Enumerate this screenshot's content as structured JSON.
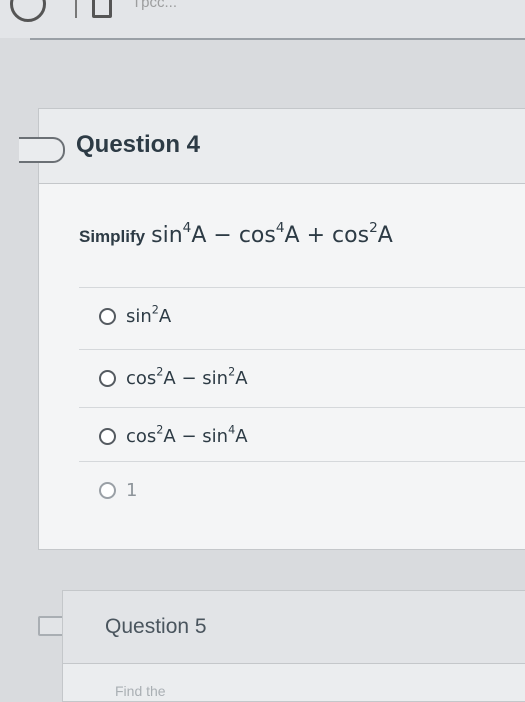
{
  "browser": {
    "tab_text": "Tpcc..."
  },
  "question4": {
    "title": "Question 4",
    "prompt_label": "Simplify",
    "expression": {
      "t1_fn": "sin",
      "t1_exp": "4",
      "t1_var": "A",
      "op1": "−",
      "t2_fn": "cos",
      "t2_exp": "4",
      "t2_var": "A",
      "op2": "+",
      "t3_fn": "cos",
      "t3_exp": "2",
      "t3_var": "A"
    },
    "answers": [
      {
        "parts": {
          "fn1": "sin",
          "exp1": "2",
          "var1": "A"
        }
      },
      {
        "parts": {
          "fn1": "cos",
          "exp1": "2",
          "var1": "A",
          "op": "−",
          "fn2": "sin",
          "exp2": "2",
          "var2": "A"
        }
      },
      {
        "parts": {
          "fn1": "cos",
          "exp1": "2",
          "var1": "A",
          "op": "−",
          "fn2": "sin",
          "exp2": "4",
          "var2": "A"
        }
      },
      {
        "parts": {
          "text": "1"
        }
      }
    ]
  },
  "question5": {
    "title": "Question 5",
    "preview": "Find the"
  },
  "colors": {
    "text": "#2d3b45",
    "card_bg": "#f4f5f6",
    "header_bg": "#eaecee"
  }
}
